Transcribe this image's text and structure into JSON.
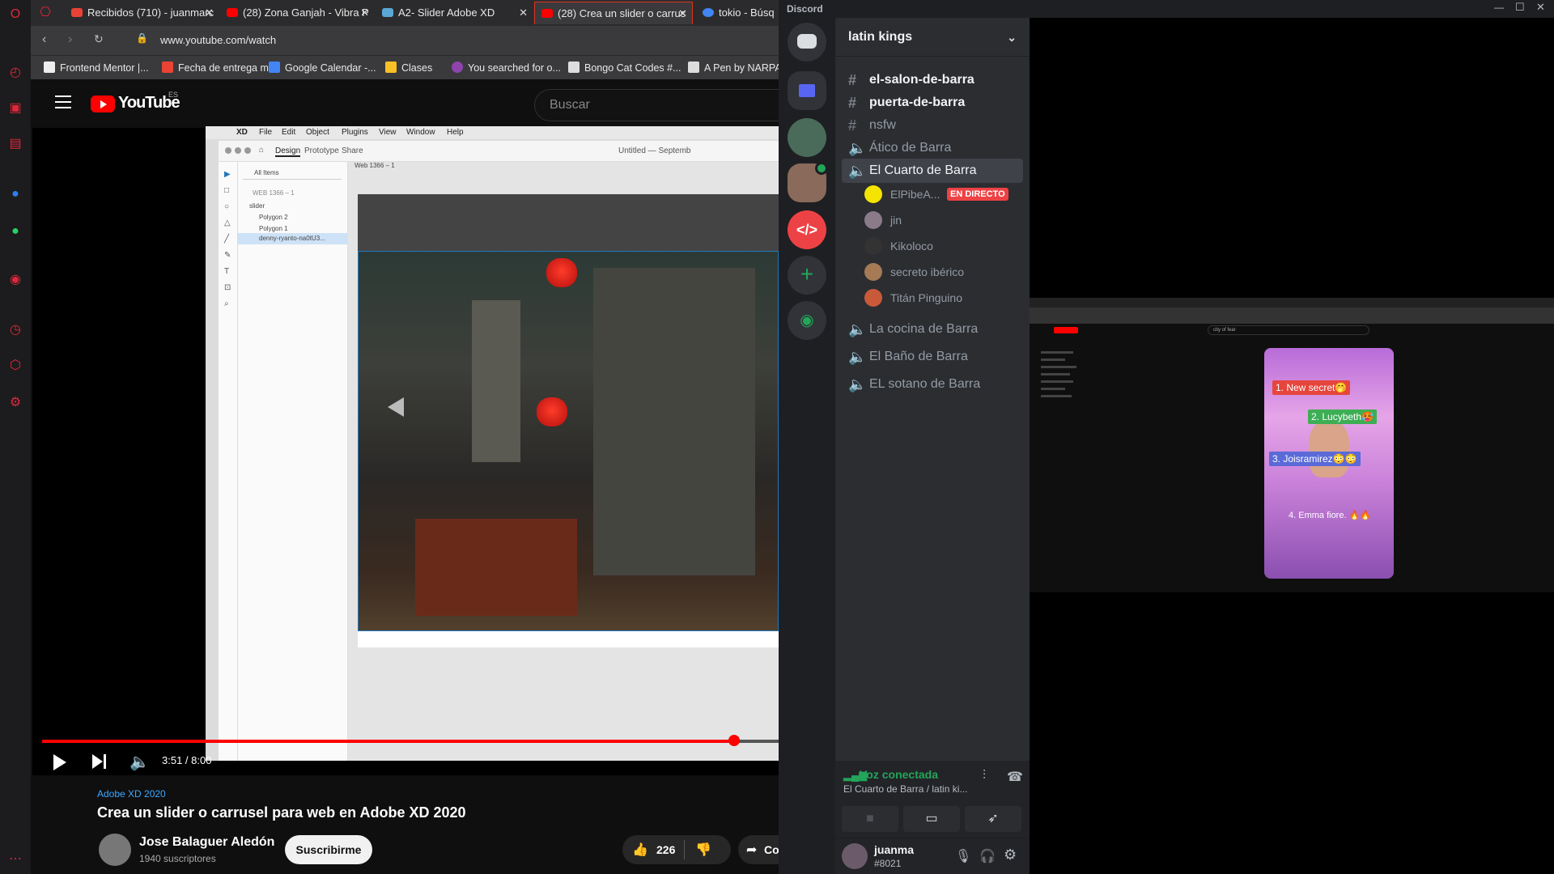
{
  "browser": {
    "tabs": [
      {
        "label": "Recibidos (710) - juanmarc",
        "fav_color": "#ea4335",
        "active": false
      },
      {
        "label": "(28) Zona Ganjah - Vibra P",
        "fav_color": "#ff0000",
        "active": false
      },
      {
        "label": "A2- Slider Adobe XD",
        "fav_color": "#5aa7d6",
        "active": false
      },
      {
        "label": "(28) Crea un slider o carrus",
        "fav_color": "#ff0000",
        "active": true
      },
      {
        "label": "tokio - Búsq",
        "fav_color": "#4285f4",
        "active": false
      }
    ],
    "url": "www.youtube.com/watch",
    "bookmarks": [
      {
        "label": "Frontend Mentor |...",
        "color": "#eee"
      },
      {
        "label": "Fecha de entrega m...",
        "color": "#ea4335"
      },
      {
        "label": "Google Calendar -...",
        "color": "#4285f4"
      },
      {
        "label": "Clases",
        "color": "#f6c026"
      },
      {
        "label": "You searched for o...",
        "color": "#8e44ad"
      },
      {
        "label": "Bongo Cat Codes #...",
        "color": "#ddd"
      },
      {
        "label": "A Pen by NARPA",
        "color": "#ddd"
      }
    ]
  },
  "youtube": {
    "logo_text": "YouTube",
    "logo_region": "ES",
    "search_placeholder": "Buscar",
    "player": {
      "time": "3:51 / 8:00",
      "progress": 0.94
    },
    "video": {
      "channel_tag": "Adobe XD 2020",
      "title": "Crea un slider o carrusel para web en Adobe XD 2020",
      "channel": "Jose Balaguer Aledón",
      "subscribers": "1940 suscriptores",
      "subscribe_label": "Suscribirme",
      "likes": "226",
      "share_label": "Co"
    }
  },
  "xd": {
    "menubar": [
      "XD",
      "File",
      "Edit",
      "Object",
      "Plugins",
      "View",
      "Window",
      "Help"
    ],
    "tabs": [
      "Design",
      "Prototype",
      "Share"
    ],
    "doc_title": "Untitled — Septemb",
    "layers_search": "All Items",
    "artboard_path": "WEB 1366 – 1",
    "layers": [
      "slider",
      "Polygon 2",
      "Polygon 1",
      "denny-ryanto-na0tU3..."
    ],
    "artboard_label": "Web 1366 – 1"
  },
  "discord": {
    "app_title": "Discord",
    "server_name": "latin kings",
    "channels": [
      {
        "name": "el-salon-de-barra",
        "type": "text",
        "unread": true
      },
      {
        "name": "puerta-de-barra",
        "type": "text",
        "unread": true
      },
      {
        "name": "nsfw",
        "type": "text",
        "unread": false
      },
      {
        "name": "Ático de Barra",
        "type": "voice",
        "unread": false
      },
      {
        "name": "El Cuarto de Barra",
        "type": "voice",
        "selected": true
      },
      {
        "name": "La cocina de Barra",
        "type": "voice",
        "unread": false
      },
      {
        "name": "El Baño de Barra",
        "type": "voice",
        "unread": false
      },
      {
        "name": "EL sotano de Barra",
        "type": "voice",
        "unread": false
      }
    ],
    "voice_users": [
      {
        "name": "ElPibeA...",
        "color": "#f5e400"
      },
      {
        "name": "jin",
        "color": "#8a7a8a"
      },
      {
        "name": "Kikoloco",
        "color": "#333"
      },
      {
        "name": "secreto ibérico",
        "color": "#a57a55"
      },
      {
        "name": "Titán Pinguino",
        "color": "#c85a3a"
      }
    ],
    "live_badge": "EN DIRECTO",
    "voice_status": "Voz conectada",
    "voice_location": "El Cuarto de Barra / latin ki...",
    "user": {
      "name": "juanma",
      "tag": "#8021"
    },
    "stream": {
      "search": "city of fear",
      "short_labels": [
        "1. New secret🤭",
        "2. Lucybeth🥵",
        "3. Joisramirez😳😳",
        "4. Emma fiore. 🔥🔥"
      ]
    }
  }
}
